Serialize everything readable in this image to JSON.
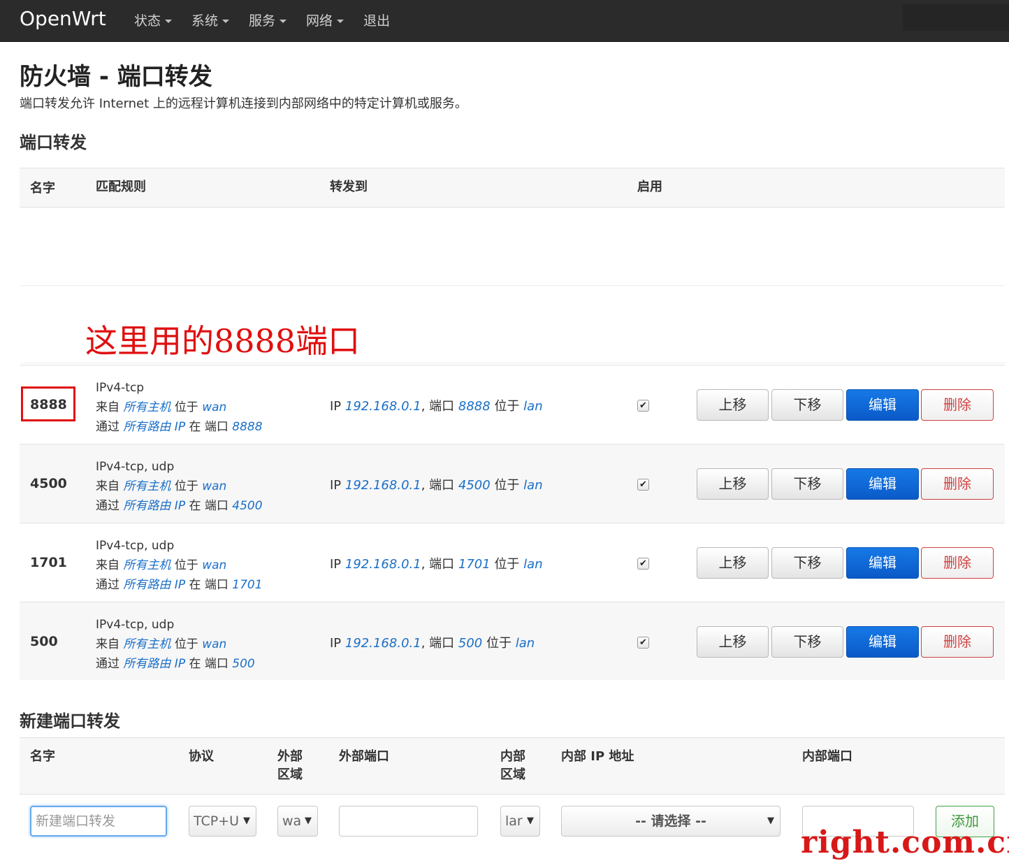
{
  "navbar": {
    "brand": "OpenWrt",
    "menu": [
      {
        "label": "状态",
        "dropdown": true
      },
      {
        "label": "系统",
        "dropdown": true
      },
      {
        "label": "服务",
        "dropdown": true
      },
      {
        "label": "网络",
        "dropdown": true
      },
      {
        "label": "退出",
        "dropdown": false
      }
    ]
  },
  "page": {
    "title": "防火墙 - 端口转发",
    "description": "端口转发允许 Internet 上的远程计算机连接到内部网络中的特定计算机或服务。"
  },
  "forwards": {
    "section_title": "端口转发",
    "headers": {
      "name": "名字",
      "match": "匹配规则",
      "forward_to": "转发到",
      "enabled": "启用"
    },
    "annotation": "这里用的8888端口",
    "labels": {
      "from": "来自",
      "at": "位于",
      "via": "通过",
      "on_port": "在 端口",
      "ip": "IP",
      "port": ", 端口",
      "comma": ","
    },
    "buttons": {
      "up": "上移",
      "down": "下移",
      "edit": "编辑",
      "delete": "删除"
    },
    "rows": [
      {
        "name": "8888",
        "proto": "IPv4-tcp",
        "src": "所有主机",
        "src_zone": "wan",
        "via": "所有路由 IP",
        "ext_port": "8888",
        "dest_ip": "192.168.0.1",
        "dest_port": "8888",
        "dest_zone": "lan",
        "enabled": true
      },
      {
        "name": "4500",
        "proto": "IPv4-tcp, udp",
        "src": "所有主机",
        "src_zone": "wan",
        "via": "所有路由 IP",
        "ext_port": "4500",
        "dest_ip": "192.168.0.1",
        "dest_port": "4500",
        "dest_zone": "lan",
        "enabled": true
      },
      {
        "name": "1701",
        "proto": "IPv4-tcp, udp",
        "src": "所有主机",
        "src_zone": "wan",
        "via": "所有路由 IP",
        "ext_port": "1701",
        "dest_ip": "192.168.0.1",
        "dest_port": "1701",
        "dest_zone": "lan",
        "enabled": true
      },
      {
        "name": "500",
        "proto": "IPv4-tcp, udp",
        "src": "所有主机",
        "src_zone": "wan",
        "via": "所有路由 IP",
        "ext_port": "500",
        "dest_ip": "192.168.0.1",
        "dest_port": "500",
        "dest_zone": "lan",
        "enabled": true
      }
    ]
  },
  "new_forward": {
    "section_title": "新建端口转发",
    "headers": {
      "name": "名字",
      "protocol": "协议",
      "ext_zone_1": "外部",
      "ext_zone_2": "区域",
      "ext_port": "外部端口",
      "int_zone_1": "内部",
      "int_zone_2": "区域",
      "int_ip": "内部 IP 地址",
      "int_port": "内部端口"
    },
    "name_placeholder": "新建端口转发",
    "protocol_value": "TCP+U",
    "ext_zone_value": "wa",
    "int_zone_value": "lar",
    "int_ip_value": "-- 请选择 --",
    "add_label": "添加"
  },
  "watermark": "right.com.cn",
  "colors": {
    "navbar": "#2b2b2b",
    "link": "#1a6fc8",
    "primary": "#0a5ac8",
    "danger": "#d04040",
    "annotation": "#e01010"
  }
}
